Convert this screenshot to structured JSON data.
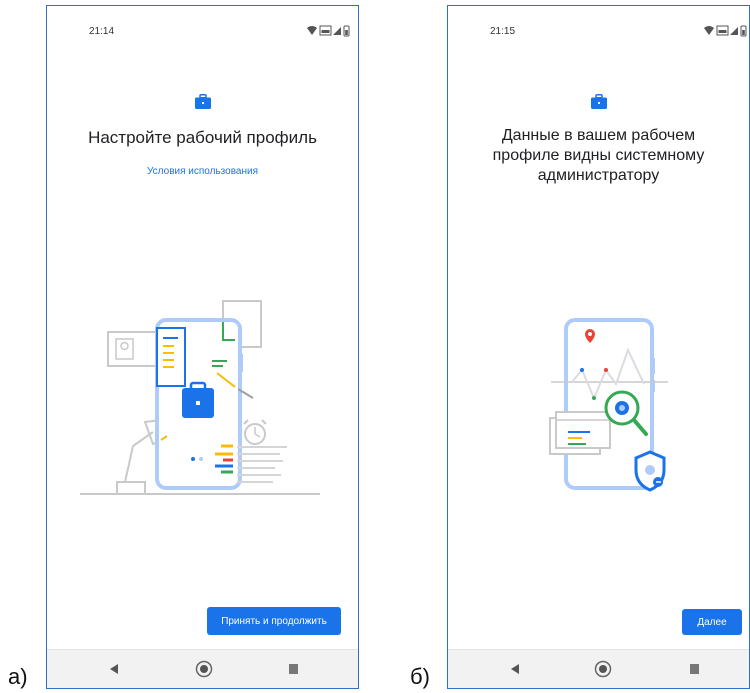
{
  "captions": {
    "left": "а)",
    "right": "б)"
  },
  "screen_a": {
    "time": "21:14",
    "title": "Настройте рабочий профиль",
    "link": "Условия использования",
    "button": "Принять и продолжить"
  },
  "screen_b": {
    "time": "21:15",
    "title_line1": "Данные в вашем рабочем",
    "title_line2": "профиле видны системному",
    "title_line3": "администратору",
    "button": "Далее"
  },
  "icons": {
    "status": [
      "wifi-icon",
      "signal-icon",
      "battery-icon"
    ],
    "nav": [
      "back-icon",
      "home-icon",
      "recents-icon"
    ],
    "header": "briefcase-icon"
  },
  "colors": {
    "accent": "#1a73e8",
    "frame": "#2f6fc4",
    "green": "#34a853",
    "yellow": "#fbbc04",
    "red": "#ea4335"
  }
}
